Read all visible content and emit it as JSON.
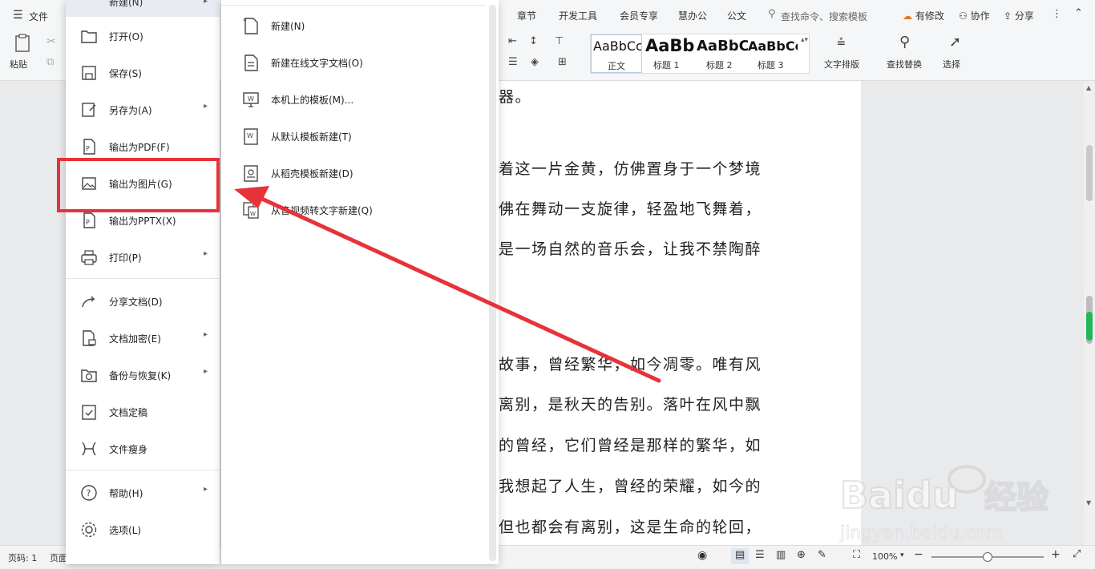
{
  "ribbon": {
    "file_menu": "文件",
    "tabs": [
      "章节",
      "开发工具",
      "会员专享",
      "慧办公",
      "公文"
    ],
    "search_placeholder": "查找命令、搜索模板",
    "right_actions": [
      "有修改",
      "协作",
      "分享"
    ],
    "paste_label": "粘贴",
    "styles": [
      {
        "preview": "AaBbCcD",
        "label": "正文"
      },
      {
        "preview": "AaBb",
        "label": "标题 1"
      },
      {
        "preview": "AaBbC(",
        "label": "标题 2"
      },
      {
        "preview": "AaBbCcl",
        "label": "标题 3"
      }
    ],
    "tools": [
      "文字排版",
      "查找替换",
      "选择"
    ]
  },
  "file_menu": {
    "top_partial": "新建(N)",
    "items": [
      {
        "label": "打开(O)",
        "icon": "folder-icon",
        "arrow": false
      },
      {
        "label": "保存(S)",
        "icon": "save-icon",
        "arrow": false
      },
      {
        "label": "另存为(A)",
        "icon": "save-as-icon",
        "arrow": true
      },
      {
        "label": "输出为PDF(F)",
        "icon": "pdf-icon",
        "arrow": false
      },
      {
        "label": "输出为图片(G)",
        "icon": "image-icon",
        "arrow": false
      },
      {
        "label": "输出为PPTX(X)",
        "icon": "pptx-icon",
        "arrow": false
      },
      {
        "label": "打印(P)",
        "icon": "printer-icon",
        "arrow": true
      },
      {
        "label": "分享文档(D)",
        "icon": "share-icon",
        "arrow": false
      },
      {
        "label": "文档加密(E)",
        "icon": "lock-doc-icon",
        "arrow": true
      },
      {
        "label": "备份与恢复(K)",
        "icon": "backup-icon",
        "arrow": true
      },
      {
        "label": "文档定稿",
        "icon": "finalize-icon",
        "arrow": false
      },
      {
        "label": "文件瘦身",
        "icon": "slim-icon",
        "arrow": false
      },
      {
        "label": "帮助(H)",
        "icon": "help-icon",
        "arrow": true
      },
      {
        "label": "选项(L)",
        "icon": "gear-icon",
        "arrow": false
      }
    ]
  },
  "submenu": {
    "items": [
      {
        "label": "新建(N)",
        "icon": "new-doc-icon"
      },
      {
        "label": "新建在线文字文档(O)",
        "icon": "new-online-doc-icon"
      },
      {
        "label": "本机上的模板(M)...",
        "icon": "local-template-icon"
      },
      {
        "label": "从默认模板新建(T)",
        "icon": "default-template-icon"
      },
      {
        "label": "从稻壳模板新建(D)",
        "icon": "docer-template-icon"
      },
      {
        "label": "从音视频转文字新建(Q)",
        "icon": "av-to-text-icon"
      }
    ]
  },
  "document": {
    "lines": [
      "器。",
      "着这一片金黄，仿佛置身于一个梦境",
      "佛在舞动一支旋律，轻盈地飞舞着，",
      "是一场自然的音乐会，让我不禁陶醉",
      "故事，曾经繁华，如今凋零。唯有风",
      "离别，是秋天的告别。落叶在风中飘",
      "的曾经，它们曾经是那样的繁华，如",
      "我想起了人生，曾经的荣耀，如今的",
      "但也都会有离别，这是生命的轮回，"
    ]
  },
  "statusbar": {
    "page": "页码: 1",
    "page2": "页面",
    "zoom": "100%"
  },
  "watermark": {
    "brand": "Baidu",
    "brand_cn": "经验",
    "url": "jingyan.baidu.com"
  },
  "colors": {
    "highlight": "#e8323a",
    "arrow": "#e8323a"
  }
}
